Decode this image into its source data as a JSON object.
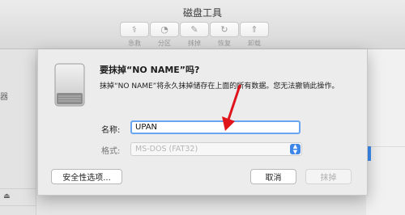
{
  "window": {
    "title": "磁盘工具"
  },
  "toolbar": {
    "items": [
      {
        "label": "急救",
        "icon": "stethoscope-icon",
        "glyph": "⚕"
      },
      {
        "label": "分区",
        "icon": "partition-icon",
        "glyph": "◔"
      },
      {
        "label": "抹掉",
        "icon": "erase-icon",
        "glyph": "✎"
      },
      {
        "label": "恢复",
        "icon": "restore-icon",
        "glyph": "↻"
      },
      {
        "label": "卸载",
        "icon": "unmount-icon",
        "glyph": "⇑"
      }
    ]
  },
  "sidebar": {
    "fragment": "器",
    "eject_glyph": "⏏"
  },
  "dialog": {
    "heading": "要抹掉“NO NAME”吗?",
    "message": "抹掉“NO NAME”将永久抹掉储存在上面的所有数据。您无法撤销此操作。",
    "name_label": "名称:",
    "name_value": "UPAN",
    "format_label": "格式:",
    "format_value": "MS-DOS (FAT32)",
    "security_button": "安全性选项...",
    "cancel_button": "取消",
    "erase_button": "抹掉"
  },
  "colors": {
    "accent": "#3e86e6",
    "annotation_arrow": "#e0141b"
  }
}
